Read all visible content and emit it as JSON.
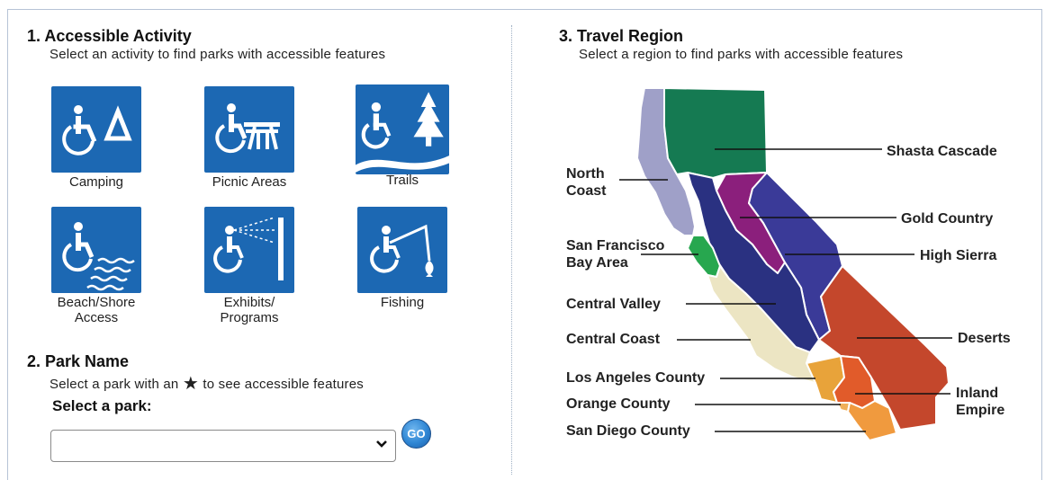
{
  "activity": {
    "title": "1. Accessible Activity",
    "subtitle": "Select an activity to find parks with accessible features",
    "items": [
      {
        "label": "Camping",
        "icon": "camping-icon"
      },
      {
        "label": "Picnic Areas",
        "icon": "picnic-icon"
      },
      {
        "label": "Trails",
        "icon": "trails-icon"
      },
      {
        "label": "Beach/Shore Access",
        "line1": "Beach/Shore",
        "line2": "Access",
        "icon": "beach-icon"
      },
      {
        "label": "Exhibits/ Programs",
        "line1": "Exhibits/",
        "line2": "Programs",
        "icon": "exhibits-icon"
      },
      {
        "label": "Fishing",
        "icon": "fishing-icon"
      }
    ]
  },
  "park": {
    "title": "2. Park Name",
    "subtitle_before": "Select a park with an",
    "star": "★",
    "subtitle_after": "to see accessible features",
    "select_label": "Select a park:",
    "select_value": "",
    "go_label": "GO"
  },
  "region": {
    "title": "3. Travel Region",
    "subtitle": "Select a region to find parks with accessible features",
    "labels": {
      "north_coast_1": "North",
      "north_coast_2": "Coast",
      "sf_1": "San Francisco",
      "sf_2": "Bay Area",
      "central_valley": "Central Valley",
      "central_coast": "Central Coast",
      "la": "Los Angeles County",
      "orange": "Orange County",
      "san_diego": "San Diego County",
      "shasta": "Shasta Cascade",
      "gold": "Gold Country",
      "high_sierra": "High Sierra",
      "deserts": "Deserts",
      "inland_1": "Inland",
      "inland_2": "Empire"
    },
    "colors": {
      "shasta": "#157a52",
      "north_coast": "#9fa0c8",
      "gold": "#8b1f7c",
      "high_sierra": "#3a3a98",
      "central_valley": "#2a3181",
      "sf": "#27a74f",
      "central_coast": "#ece5c3",
      "deserts": "#c4472c",
      "la": "#e8a33a",
      "inland": "#e15b2a",
      "orange": "#f0b05a",
      "san_diego": "#f09a3e"
    }
  }
}
